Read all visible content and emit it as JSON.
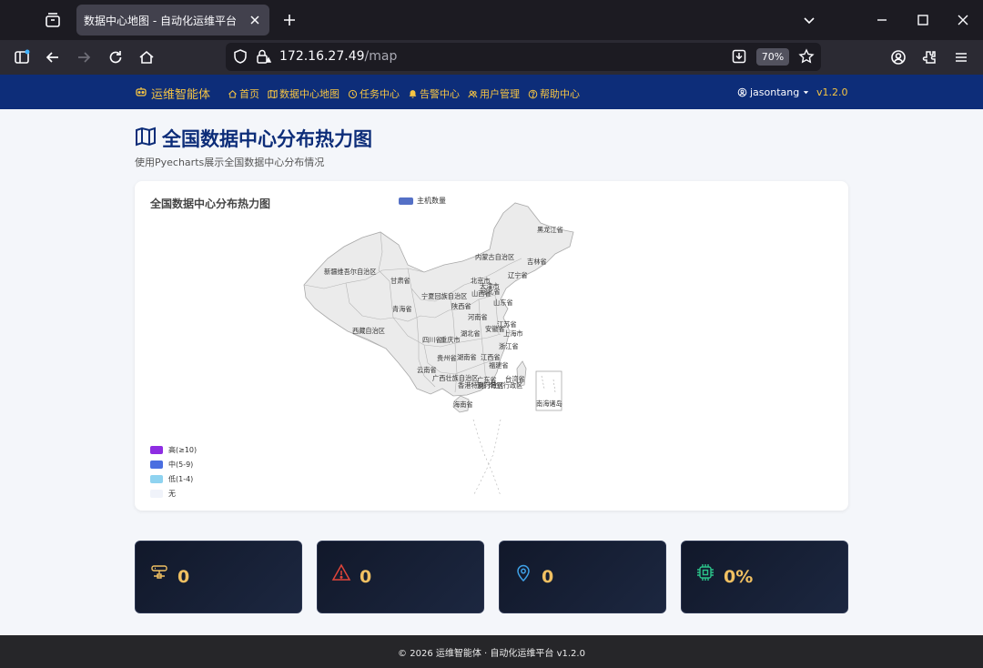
{
  "browser": {
    "tab_title": "数据中心地图 - 自动化运维平台",
    "url_host": "172.16.27.49",
    "url_path": "/map",
    "zoom": "70%"
  },
  "app": {
    "brand": "运维智能体",
    "menu": [
      {
        "label": "首页",
        "icon": "home-icon"
      },
      {
        "label": "数据中心地图",
        "icon": "map-icon"
      },
      {
        "label": "任务中心",
        "icon": "clock-icon"
      },
      {
        "label": "告警中心",
        "icon": "bell-icon"
      },
      {
        "label": "用户管理",
        "icon": "users-icon"
      },
      {
        "label": "帮助中心",
        "icon": "help-icon"
      }
    ],
    "user": "jasontang",
    "version": "v1.2.0"
  },
  "page": {
    "title": "全国数据中心分布热力图",
    "subtitle": "使用Pyecharts展示全国数据中心分布情况"
  },
  "chart_data": {
    "type": "map",
    "title": "全国数据中心分布热力图",
    "series": [
      {
        "name": "主机数量",
        "color": "#5470c6",
        "values": []
      }
    ],
    "visual_map": [
      {
        "label": "高(≥10)",
        "color": "#8e2de2"
      },
      {
        "label": "中(5-9)",
        "color": "#4a6ee0"
      },
      {
        "label": "低(1-4)",
        "color": "#8fd3f0"
      },
      {
        "label": "无",
        "color": "#f0f3fa"
      }
    ],
    "region_labels": [
      "黑龙江省",
      "内蒙古自治区",
      "吉林省",
      "新疆维吾尔自治区",
      "甘肃省",
      "辽宁省",
      "北京市",
      "天津市",
      "河北省",
      "宁夏回族自治区",
      "山西省",
      "山东省",
      "青海省",
      "陕西省",
      "河南省",
      "江苏省",
      "安徽省",
      "上海市",
      "西藏自治区",
      "四川省",
      "重庆市",
      "湖北省",
      "浙江省",
      "贵州省",
      "湖南省",
      "江西省",
      "福建省",
      "云南省",
      "广西壮族自治区",
      "广东省",
      "台湾省",
      "香港特别行政区",
      "澳门特别行政区",
      "海南省",
      "南海诸岛"
    ]
  },
  "stats": [
    {
      "value": "0",
      "icon": "server-icon",
      "color": "#f0c062"
    },
    {
      "value": "0",
      "icon": "warning-icon",
      "color": "#e0453a"
    },
    {
      "value": "0",
      "icon": "location-pin-icon",
      "color": "#3fa2e8"
    },
    {
      "value": "0%",
      "icon": "cpu-chip-icon",
      "color": "#2bc48a"
    }
  ],
  "footer": "© 2026 运维智能体 · 自动化运维平台 v1.2.0"
}
